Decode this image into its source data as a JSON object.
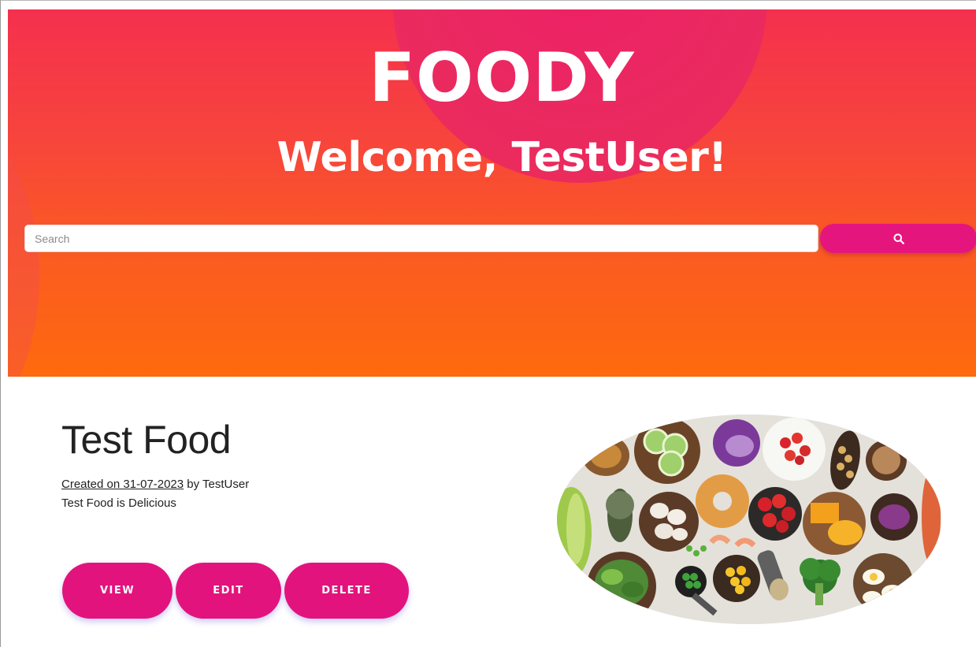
{
  "header": {
    "brand": "FOODY",
    "welcome": "Welcome, TestUser!"
  },
  "search": {
    "placeholder": "Search",
    "value": "",
    "button_icon": "search-icon"
  },
  "colors": {
    "accent": "#e5157e",
    "hero_top": "#f5304e",
    "hero_bottom": "#fe6a0d"
  },
  "card": {
    "title": "Test Food",
    "created": "Created on 31-07-2023",
    "author_text": " by TestUser",
    "description": "Test Food is Delicious",
    "buttons": {
      "view": "VIEW",
      "edit": "EDIT",
      "delete": "DELETE"
    },
    "image_subject": "overhead-bowls-of-fresh-ingredients"
  }
}
